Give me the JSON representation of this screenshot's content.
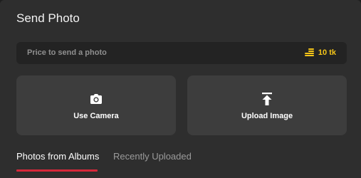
{
  "dialog": {
    "title": "Send Photo"
  },
  "price": {
    "label": "Price to send a photo",
    "value": "10 tk",
    "icon": "coins-icon",
    "accent_color": "#f5c518"
  },
  "actions": [
    {
      "label": "Use Camera",
      "icon": "camera-icon"
    },
    {
      "label": "Upload Image",
      "icon": "upload-icon"
    }
  ],
  "tabs": [
    {
      "label": "Photos from Albums",
      "active": true
    },
    {
      "label": "Recently Uploaded",
      "active": false
    }
  ],
  "colors": {
    "background": "#2e2e2e",
    "tab_indicator": "#d6283a"
  }
}
